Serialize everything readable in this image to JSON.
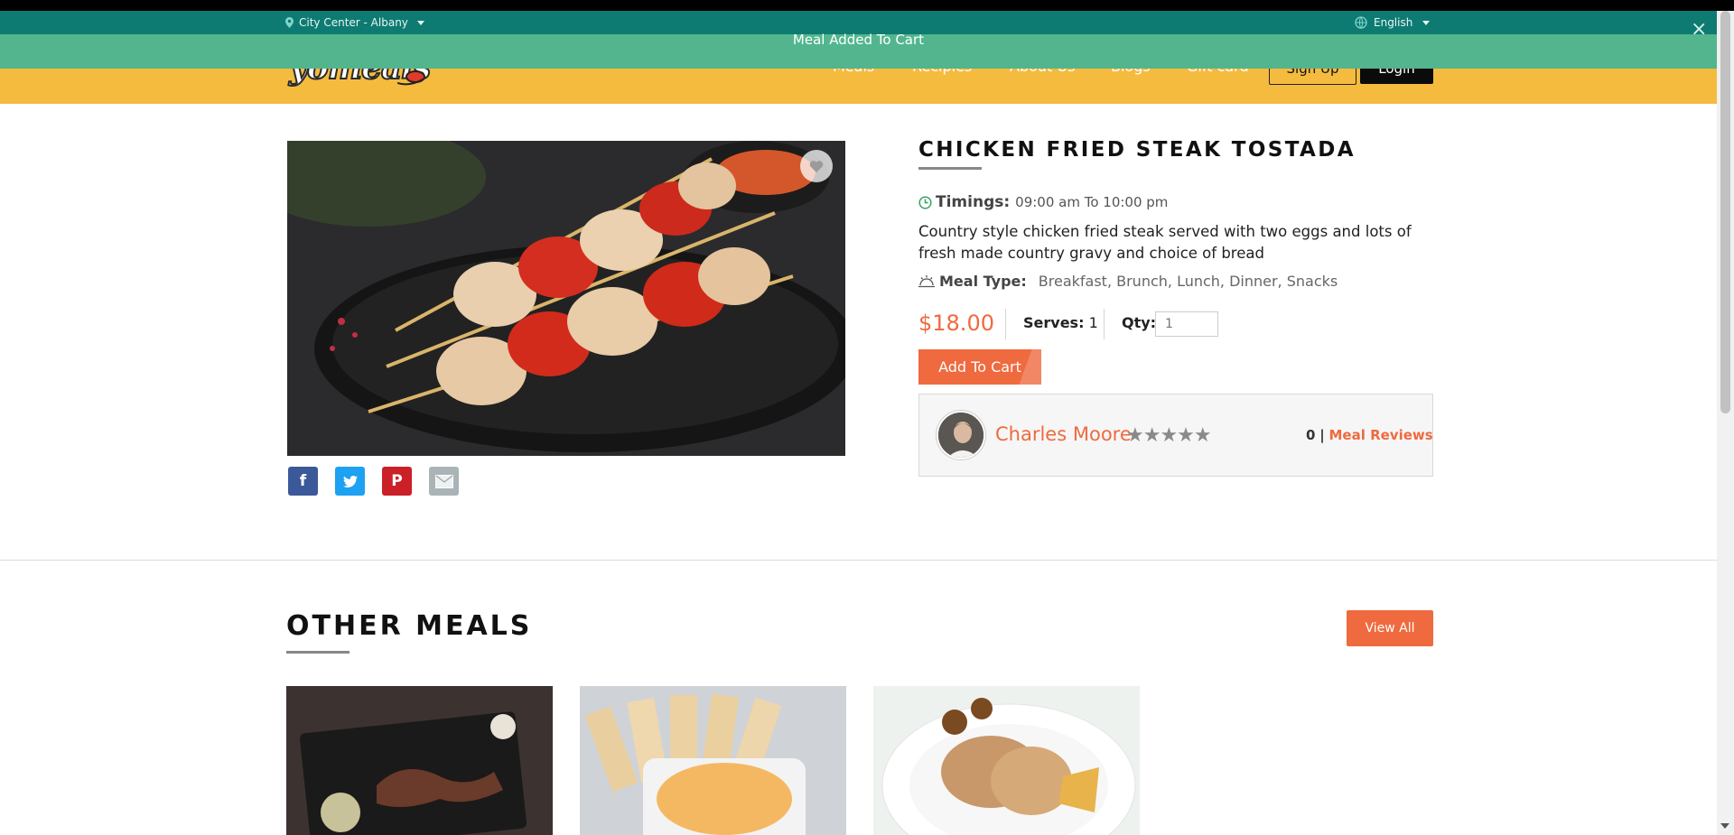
{
  "header": {
    "location": "City Center - Albany",
    "language": "English",
    "logo_text": "yomeals",
    "nav": [
      {
        "label": "Meals"
      },
      {
        "label": "Recipies"
      },
      {
        "label": "About Us"
      },
      {
        "label": "Blogs"
      },
      {
        "label": "Gift card"
      }
    ],
    "signup_label": "Sign Up",
    "login_label": "Login"
  },
  "toast": {
    "message": "Meal Added To Cart",
    "close": "×"
  },
  "product": {
    "title": "CHICKEN FRIED STEAK TOSTADA",
    "timings_label": "Timings:",
    "timings_value": "09:00 am To 10:00 pm",
    "description": "Country style chicken fried steak served with two eggs and lots of fresh made country gravy and choice of bread",
    "meal_type_label": "Meal Type:",
    "meal_type_value": "Breakfast, Brunch, Lunch, Dinner, Snacks",
    "price": "$18.00",
    "serves_label": "Serves:",
    "serves_value": "1",
    "qty_label": "Qty:",
    "qty_placeholder": "1",
    "add_to_cart": "Add To Cart"
  },
  "share": [
    {
      "icon": "facebook-icon",
      "glyph": "f",
      "color": "#3b5998"
    },
    {
      "icon": "twitter-icon",
      "glyph": "t",
      "color": "#1da1f2"
    },
    {
      "icon": "pinterest-icon",
      "glyph": "P",
      "color": "#cb2027"
    },
    {
      "icon": "email-icon",
      "glyph": "✉",
      "color": "#aab4b6"
    }
  ],
  "chef": {
    "name": "Charles Moore",
    "stars": "★★★★★",
    "rating_count": "0",
    "separator": "|",
    "reviews_link": "Meal Reviews"
  },
  "other_meals": {
    "title": "OTHER MEALS",
    "view_all": "View All"
  },
  "colors": {
    "accent": "#ef6a3f",
    "header_yellow": "#f5bb3f",
    "topbar_teal": "#0e7b73",
    "toast_green": "#52b58e"
  }
}
